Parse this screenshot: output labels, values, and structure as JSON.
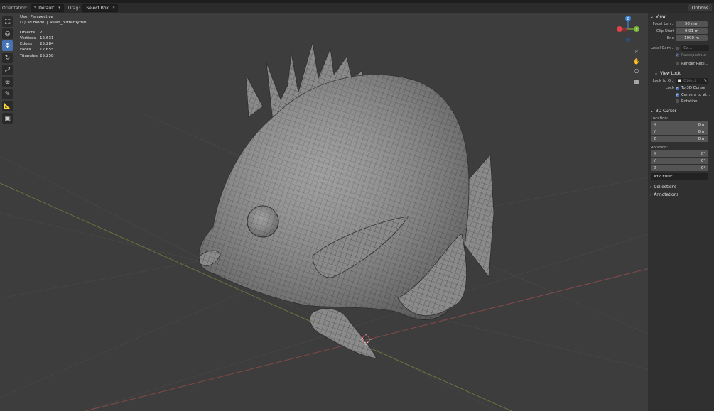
{
  "header": {
    "orientation_label": "Orientation:",
    "orientation_value": "Default",
    "drag_label": "Drag:",
    "drag_value": "Select Box",
    "options_label": "Options"
  },
  "overlay": {
    "view_name": "User Perspective",
    "object_line": "(1) 3d model | Asian_butterflyfish",
    "stats": [
      {
        "label": "Objects",
        "value": "2"
      },
      {
        "label": "Vertices",
        "value": "12,631"
      },
      {
        "label": "Edges",
        "value": "25,284"
      },
      {
        "label": "Faces",
        "value": "12,655"
      },
      {
        "label": "Triangles",
        "value": "25,258"
      }
    ]
  },
  "toolbar": {
    "tools": [
      "select-box",
      "cursor",
      "move",
      "rotate",
      "scale",
      "transform",
      "annotate",
      "measure",
      "add-cube"
    ],
    "active": "move"
  },
  "gizmo": {
    "z_label": "Z",
    "y_label": "Y",
    "x_color": "#e0424a",
    "y_color": "#7ab83a",
    "z_color": "#3f86d6"
  },
  "npanel": {
    "view": {
      "title": "View",
      "focal_label": "Focal Len...",
      "focal_value": "50 mm",
      "clip_start_label": "Clip Start",
      "clip_start_value": "0.01 m",
      "end_label": "End",
      "end_value": "1000 m",
      "local_cam_label": "Local Cam...",
      "local_cam_value": "Ca...",
      "passepartout_label": "Passepartout",
      "render_region_label": "Render Regi..."
    },
    "view_lock": {
      "title": "View Lock",
      "lock_to_label": "Lock to O...",
      "lock_to_placeholder": "Object",
      "lock_label": "Lock",
      "to_3d_cursor": "To 3D Cursor",
      "camera_to_view": "Camera to Vi...",
      "rotation": "Rotation"
    },
    "cursor": {
      "title": "3D Cursor",
      "location_label": "Location:",
      "loc": [
        {
          "axis": "X",
          "value": "0 m"
        },
        {
          "axis": "Y",
          "value": "0 m"
        },
        {
          "axis": "Z",
          "value": "0 m"
        }
      ],
      "rotation_label": "Rotation:",
      "rot": [
        {
          "axis": "X",
          "value": "0°"
        },
        {
          "axis": "Y",
          "value": "0°"
        },
        {
          "axis": "Z",
          "value": "0°"
        }
      ],
      "mode_value": "XYZ Euler"
    },
    "collections_title": "Collections",
    "annotations_title": "Annotations"
  }
}
